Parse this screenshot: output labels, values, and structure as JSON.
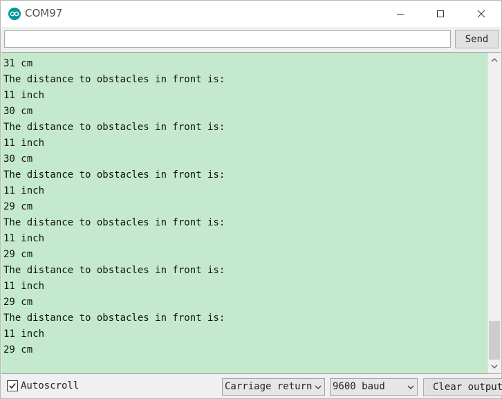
{
  "window": {
    "title": "COM97",
    "app_icon": "arduino-logo",
    "controls": [
      "minimize-icon",
      "maximize-icon",
      "close-icon"
    ]
  },
  "input_row": {
    "value": "",
    "placeholder": "",
    "send_label": "Send"
  },
  "output": {
    "background_color": "#c5e9cc",
    "lines": [
      "31 cm",
      "The distance to obstacles in front is:",
      "11 inch",
      "30 cm",
      "The distance to obstacles in front is:",
      "11 inch",
      "30 cm",
      "The distance to obstacles in front is:",
      "11 inch",
      "29 cm",
      "The distance to obstacles in front is:",
      "11 inch",
      "29 cm",
      "The distance to obstacles in front is:",
      "11 inch",
      "29 cm",
      "The distance to obstacles in front is:",
      "11 inch",
      "29 cm"
    ]
  },
  "bottom_bar": {
    "autoscroll_label": "Autoscroll",
    "autoscroll_checked": true,
    "line_ending": "Carriage return",
    "baud_rate": "9600 baud",
    "clear_label": "Clear output"
  }
}
